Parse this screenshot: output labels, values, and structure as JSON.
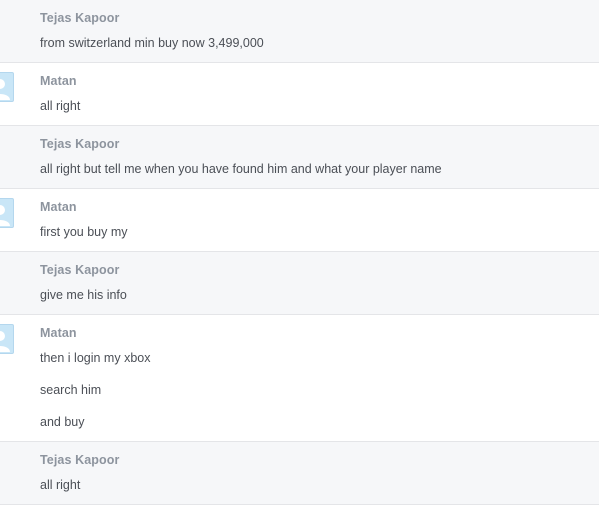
{
  "messages": [
    {
      "author": "Tejas Kapoor",
      "lines": [
        "from switzerland min buy now 3,499,000"
      ],
      "avatar": null
    },
    {
      "author": "Matan",
      "lines": [
        "all right"
      ],
      "avatar": "default-user-avatar-icon"
    },
    {
      "author": "Tejas Kapoor",
      "lines": [
        "all right but tell me when you have found him and what your player name"
      ],
      "avatar": null
    },
    {
      "author": "Matan",
      "lines": [
        "first you buy my"
      ],
      "avatar": "default-user-avatar-icon"
    },
    {
      "author": "Tejas Kapoor",
      "lines": [
        "give me his info"
      ],
      "avatar": null
    },
    {
      "author": "Matan",
      "lines": [
        "then i login my xbox",
        "search him",
        "and buy"
      ],
      "avatar": "default-user-avatar-icon"
    },
    {
      "author": "Tejas Kapoor",
      "lines": [
        "all right"
      ],
      "avatar": null
    }
  ],
  "colors": {
    "alt_row_bg": "#f6f7f9",
    "row_bg": "#ffffff",
    "author_text": "#8d949e",
    "message_text": "#4b4f56",
    "divider": "#e4e5e8",
    "avatar_bg": "#c9e6f7"
  }
}
